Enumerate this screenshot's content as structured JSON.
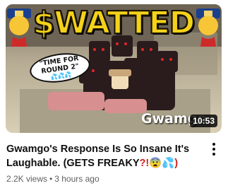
{
  "thumbnail": {
    "headline": "$WATTED",
    "bubble_line1": "\"TIME FOR",
    "bubble_line2": "ROUND 2\"",
    "bubble_drops": "💦💦💦",
    "channel_watermark": "Gwamgo",
    "duration": "10:53"
  },
  "video": {
    "title_text": "Gwamgo's Response Is So Insane It's Laughable. (GETS FREAKY",
    "title_emoji": "?!😨💦)",
    "views": "2.2K views",
    "separator": "•",
    "age": "3 hours ago"
  },
  "icons": {
    "menu": "more-vert-icon"
  },
  "colors": {
    "title_text": "#0f0f0f",
    "meta_text": "#606060",
    "headline": "#f4d21a"
  }
}
